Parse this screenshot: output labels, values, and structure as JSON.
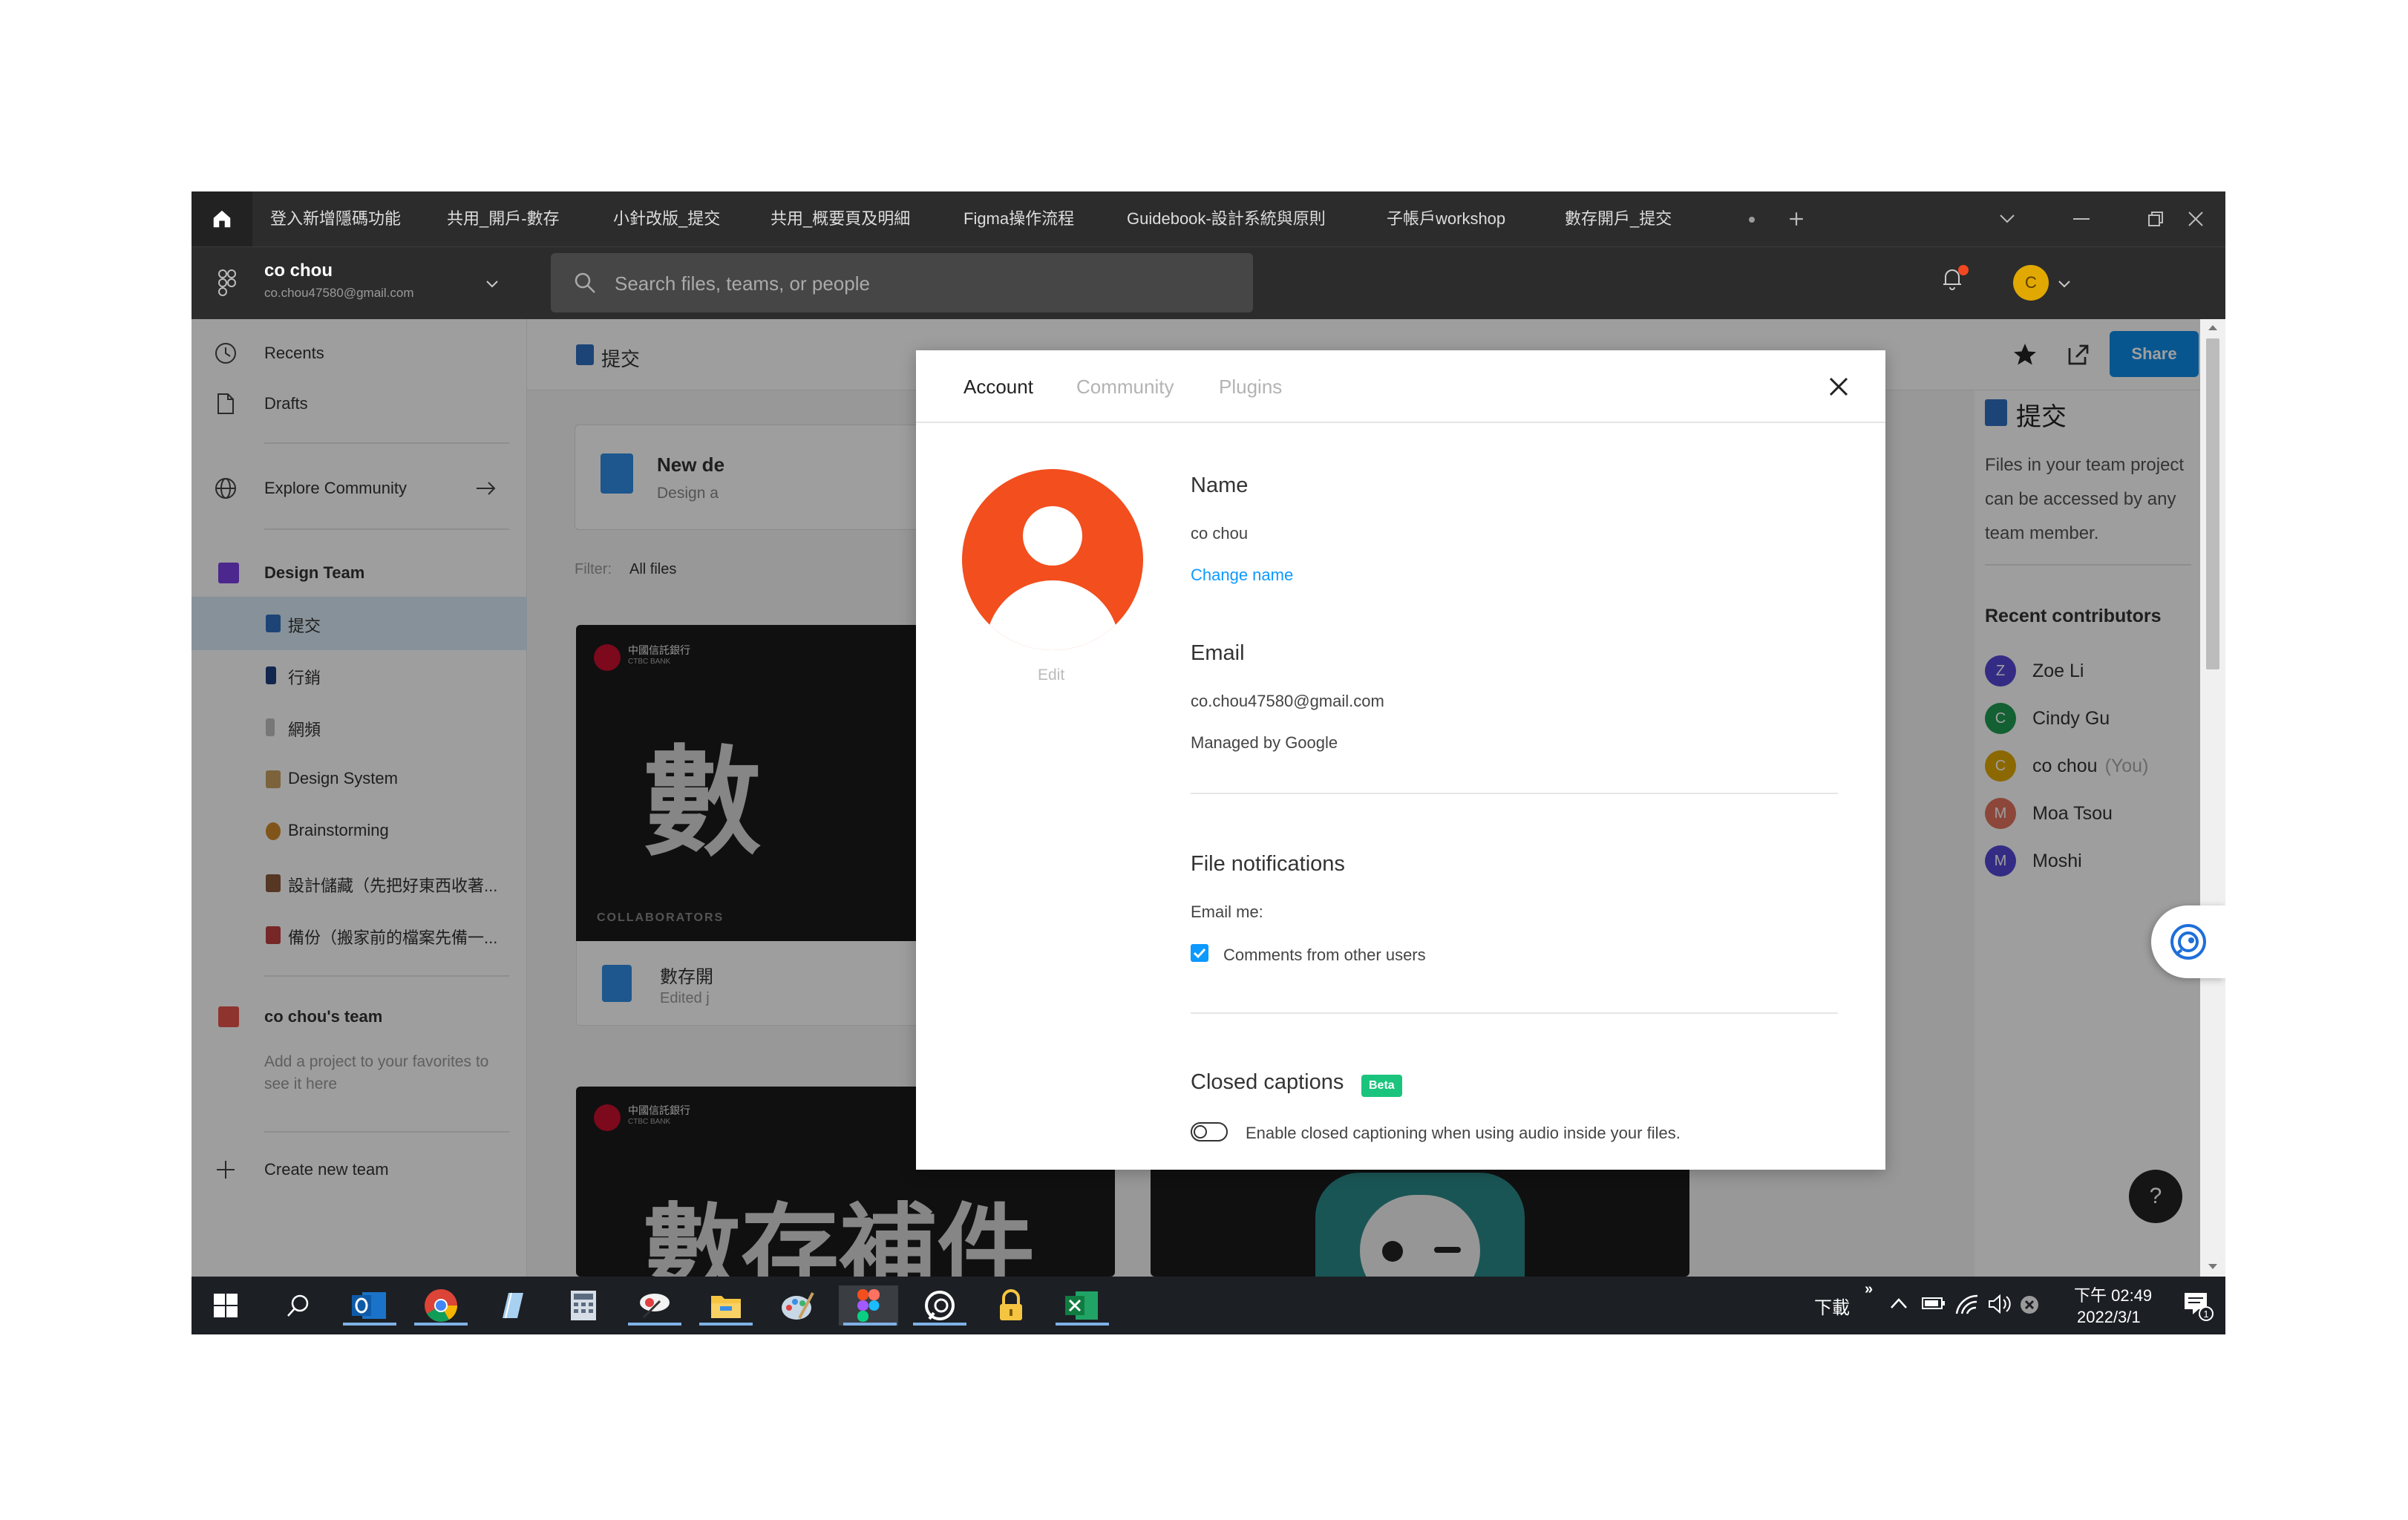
{
  "tabs": [
    {
      "label": "登入新增隱碼功能"
    },
    {
      "label": "共用_開戶-數存"
    },
    {
      "label": "小針改版_提交"
    },
    {
      "label": "共用_概要頁及明細"
    },
    {
      "label": "Figma操作流程"
    },
    {
      "label": "Guidebook-設計系統與原則"
    },
    {
      "label": "子帳戶workshop"
    },
    {
      "label": "數存開戶_提交"
    }
  ],
  "account": {
    "name": "co chou",
    "email": "co.chou47580@gmail.com",
    "avatar_letter": "C"
  },
  "search": {
    "placeholder": "Search files, teams, or people"
  },
  "sidebar": {
    "recents": "Recents",
    "drafts": "Drafts",
    "explore": "Explore Community",
    "team1": "Design Team",
    "projects": [
      {
        "label": "提交",
        "color": "#2f6fbf"
      },
      {
        "label": "行銷",
        "color": "#1f3f7f"
      },
      {
        "label": "網頻",
        "color": "#a0a0a0"
      },
      {
        "label": "Design System",
        "color": "#c8a060"
      },
      {
        "label": "Brainstorming",
        "color": "#d08a2a"
      },
      {
        "label": "設計儲藏（先把好東西收著...",
        "color": "#8a5a3a"
      },
      {
        "label": "備份（搬家前的檔案先備一...",
        "color": "#c04040"
      }
    ],
    "team2": "co chou's team",
    "team2_hint": "Add a project to your favorites to see it here",
    "create_team": "Create new team"
  },
  "main": {
    "project_title": "提交",
    "new_design": "New de",
    "new_design_sub": "Design a",
    "filter_label": "Filter:",
    "filter_value": "All files",
    "card1_title": "數存開",
    "card1_sub": "Edited j",
    "card_bank": "中國信託銀行",
    "card_bank_en": "CTBC BANK",
    "card_big_text": "數",
    "card_collab": "COLLABORATORS",
    "card2_big_text": "數存補件",
    "share": "Share"
  },
  "rpanel": {
    "title": "提交",
    "desc": "Files in your team project can be accessed by any team member.",
    "contributors_title": "Recent contributors",
    "contributors": [
      {
        "name": "Zoe Li",
        "letter": "Z",
        "color": "#5447d6",
        "you": ""
      },
      {
        "name": "Cindy Gu",
        "letter": "C",
        "color": "#1f9c52",
        "you": ""
      },
      {
        "name": "co chou",
        "letter": "C",
        "color": "#e0a800",
        "you": "(You)"
      },
      {
        "name": "Moa Tsou",
        "letter": "M",
        "color": "#e3735e",
        "you": ""
      },
      {
        "name": "Moshi",
        "letter": "M",
        "color": "#5447d6",
        "you": ""
      }
    ]
  },
  "modal": {
    "tabs": {
      "account": "Account",
      "community": "Community",
      "plugins": "Plugins"
    },
    "edit": "Edit",
    "name_title": "Name",
    "name_value": "co chou",
    "change_name": "Change name",
    "email_title": "Email",
    "email_value": "co.chou47580@gmail.com",
    "managed": "Managed by Google",
    "notif_title": "File notifications",
    "email_me": "Email me:",
    "comments_label": "Comments from other users",
    "comments_checked": true,
    "captions_title": "Closed captions",
    "beta": "Beta",
    "captions_label": "Enable closed captioning when using audio inside your files.",
    "captions_enabled": false
  },
  "taskbar": {
    "download": "下載",
    "time": "下午 02:49",
    "date": "2022/3/1",
    "notif_count": "1"
  },
  "colors": {
    "accent": "#0d99ff",
    "share": "#0d8ce9",
    "avatar_orange": "#f24e1e",
    "beta_green": "#1bc47d"
  }
}
